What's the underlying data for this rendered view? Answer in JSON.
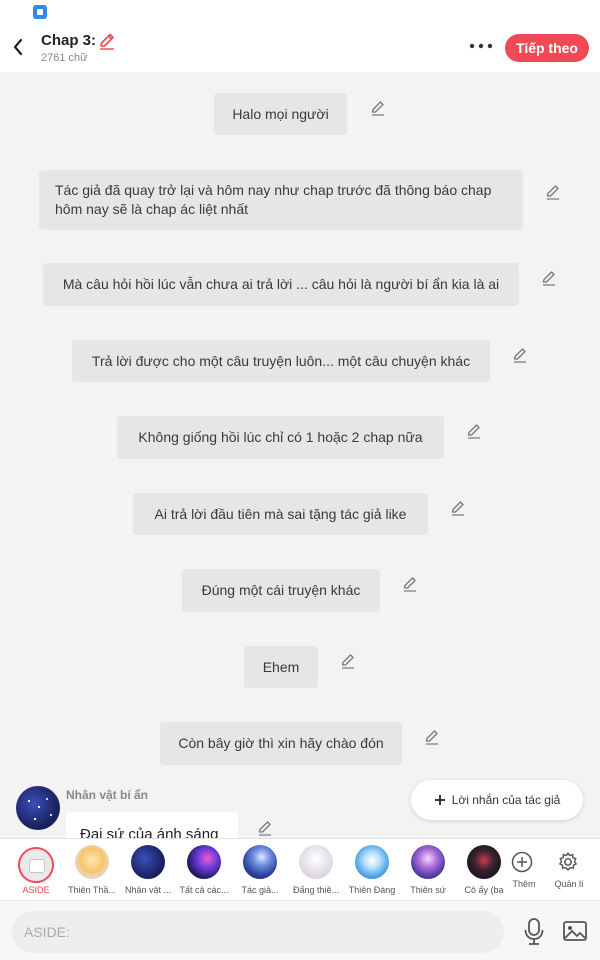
{
  "header": {
    "title": "Chap 3:",
    "word_count": "2761 chữ",
    "next_label": "Tiếp theo"
  },
  "messages": [
    {
      "text": "Halo mọi người"
    },
    {
      "text": "Tác giả đã quay trở lại và hôm nay như chap trước đã thông báo chap hôm nay sẽ là chap ác liệt nhất"
    },
    {
      "text": "Mà câu hỏi hồi lúc vẫn chưa ai trả lời ... câu hỏi là người bí ẩn kia là ai"
    },
    {
      "text": "Trả lời được cho một câu truyện luôn... một câu chuyện khác"
    },
    {
      "text": "Không giống hồi lúc chỉ có 1 hoặc 2 chap nữa"
    },
    {
      "text": "Ai trả lời đầu tiên mà sai tặng tác giả like"
    },
    {
      "text": "Đúng một cái truyện khác"
    },
    {
      "text": "Ehem"
    },
    {
      "text": "Còn bây giờ thì xin hãy chào đón"
    }
  ],
  "character_message": {
    "name": "Nhân vật bí ẩn",
    "text": "Đại sứ của ánh sáng"
  },
  "author_message_button": {
    "label": "Lời nhắn của tác giả"
  },
  "character_bar": {
    "items": [
      {
        "label": "ASIDE",
        "icon": "aside-icon"
      },
      {
        "label": "Thiên Thầ...",
        "icon": "avatar-anime-girl"
      },
      {
        "label": "Nhân vật ...",
        "icon": "avatar-galaxy"
      },
      {
        "label": "Tất cả các...",
        "icon": "avatar-nebula"
      },
      {
        "label": "Tác giả...",
        "icon": "avatar-blue-figure"
      },
      {
        "label": "Đấng thiê...",
        "icon": "avatar-white-figure"
      },
      {
        "label": "Thiên Đàng",
        "icon": "avatar-heaven-light"
      },
      {
        "label": "Thiên sứ",
        "icon": "avatar-purple-angel"
      },
      {
        "label": "Cô ấy (bạ",
        "icon": "avatar-dark-figure"
      },
      {
        "label": "Thêm",
        "icon": "plus-circle-icon"
      },
      {
        "label": "Quản lí",
        "icon": "gear-icon"
      }
    ]
  },
  "input": {
    "placeholder": "ASIDE:"
  },
  "colors": {
    "accent": "#ef4a55",
    "bubble": "#e6e6e6",
    "background": "#f3f3f3"
  }
}
